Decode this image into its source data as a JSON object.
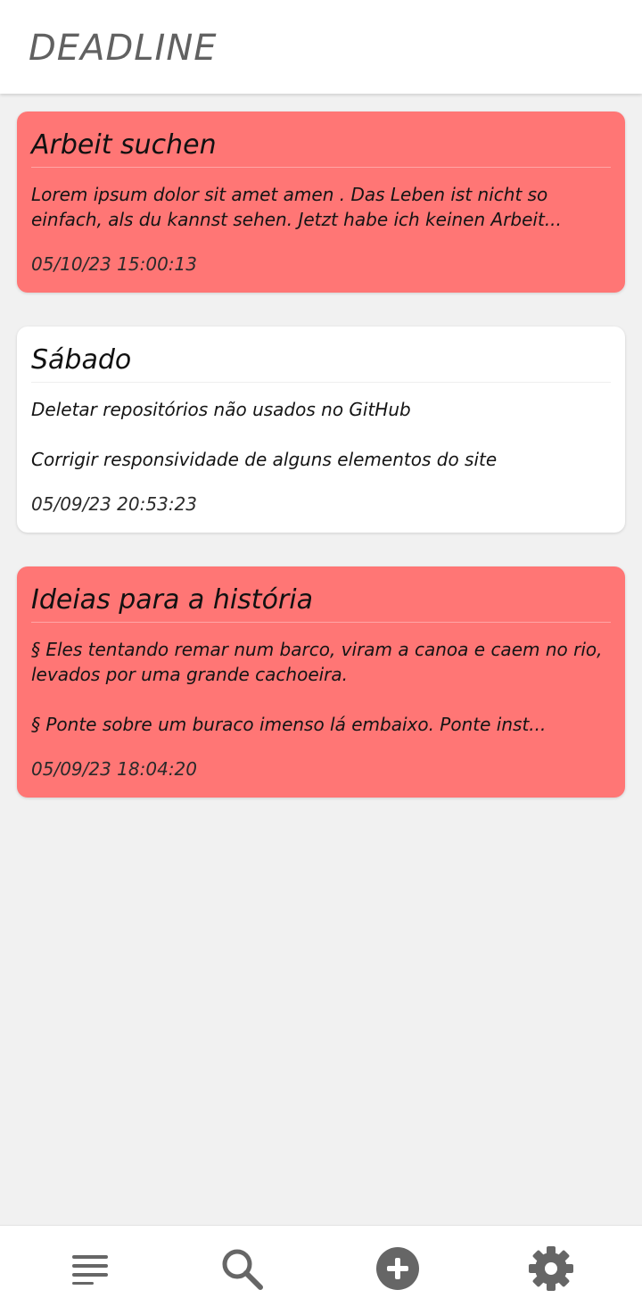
{
  "header": {
    "title": "DEADLINE"
  },
  "notes": [
    {
      "title": "Arbeit suchen",
      "body": "Lorem ipsum dolor sit amet amen . Das Leben ist nicht so einfach, als du kannst sehen. Jetzt habe ich keinen Arbeit...",
      "date": "05/10/23 15:00:13",
      "color": "#ff7675"
    },
    {
      "title": "Sábado",
      "body": "Deletar repositórios não usados no GitHub\n\nCorrigir responsividade de alguns elementos do site",
      "date": "05/09/23 20:53:23",
      "color": "#ffffff"
    },
    {
      "title": "Ideias para a história",
      "body": "§ Eles tentando remar num barco, viram a canoa e caem no rio, levados por uma grande cachoeira.\n\n§ Ponte sobre um buraco imenso lá embaixo. Ponte inst...",
      "date": "05/09/23 18:04:20",
      "color": "#ff7675"
    }
  ],
  "bottom_nav": {
    "items": [
      {
        "icon": "menu-icon"
      },
      {
        "icon": "search-icon"
      },
      {
        "icon": "add-circle-icon"
      },
      {
        "icon": "gear-icon"
      }
    ],
    "icon_color": "#666666"
  }
}
